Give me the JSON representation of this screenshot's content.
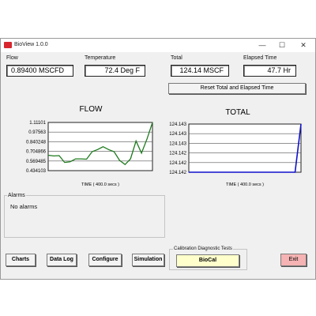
{
  "window": {
    "title": "BioView 1.0.0",
    "controls": {
      "minimize": "—",
      "maximize": "☐",
      "close": "✕"
    }
  },
  "readouts": {
    "flow": {
      "label": "Flow",
      "value": "0.89400 MSCFD"
    },
    "temperature": {
      "label": "Temperature",
      "value": "72.4 Deg F"
    },
    "total": {
      "label": "Total",
      "value": "124.14 MSCF"
    },
    "elapsed": {
      "label": "Elapsed Time",
      "value": "47.7 Hr"
    }
  },
  "reset_button": "Reset Total and Elapsed Time",
  "alarms": {
    "label": "Alarms",
    "message": "No alarms"
  },
  "buttons": {
    "charts": "Charts",
    "data_log": "Data Log",
    "configure": "Configure",
    "simulation": "Simulation",
    "exit": "Exit"
  },
  "calibration": {
    "label": "Calibration Diagnostic Tests",
    "button": "BioCal"
  },
  "colors": {
    "flow_line": "#1e7a1e",
    "total_line": "#1010cc",
    "exit_button": "#f5b3b3",
    "biocal_button": "#ffffcc"
  },
  "chart_data": [
    {
      "type": "line",
      "title": "FLOW",
      "xlabel": "TIME ( 400.0 secs )",
      "ylabel": "",
      "x_range": [
        0,
        400
      ],
      "y_ticks": [
        "1.11101",
        "0.97563",
        "0.840248",
        "0.704866",
        "0.569485",
        "0.434103"
      ],
      "ylim": [
        0.434103,
        1.11101
      ],
      "grid": true,
      "series": [
        {
          "values": [
            0.65,
            0.64,
            0.645,
            0.55,
            0.56,
            0.6,
            0.6,
            0.595,
            0.7,
            0.73,
            0.77,
            0.73,
            0.7,
            0.58,
            0.52,
            0.6,
            0.85,
            0.68,
            0.88,
            1.11
          ]
        }
      ]
    },
    {
      "type": "line",
      "title": "TOTAL",
      "xlabel": "TIME ( 400.0 secs )",
      "ylabel": "",
      "x_range": [
        0,
        400
      ],
      "y_ticks": [
        "124.143",
        "124.143",
        "124.143",
        "124.142",
        "124.142",
        "124.142"
      ],
      "ylim": [
        124.142,
        124.143
      ],
      "grid": true,
      "series": [
        {
          "values": [
            124.142,
            124.142,
            124.142,
            124.142,
            124.142,
            124.142,
            124.142,
            124.142,
            124.142,
            124.142,
            124.142,
            124.142,
            124.142,
            124.142,
            124.142,
            124.142,
            124.142,
            124.142,
            124.142,
            124.143
          ]
        }
      ]
    }
  ]
}
